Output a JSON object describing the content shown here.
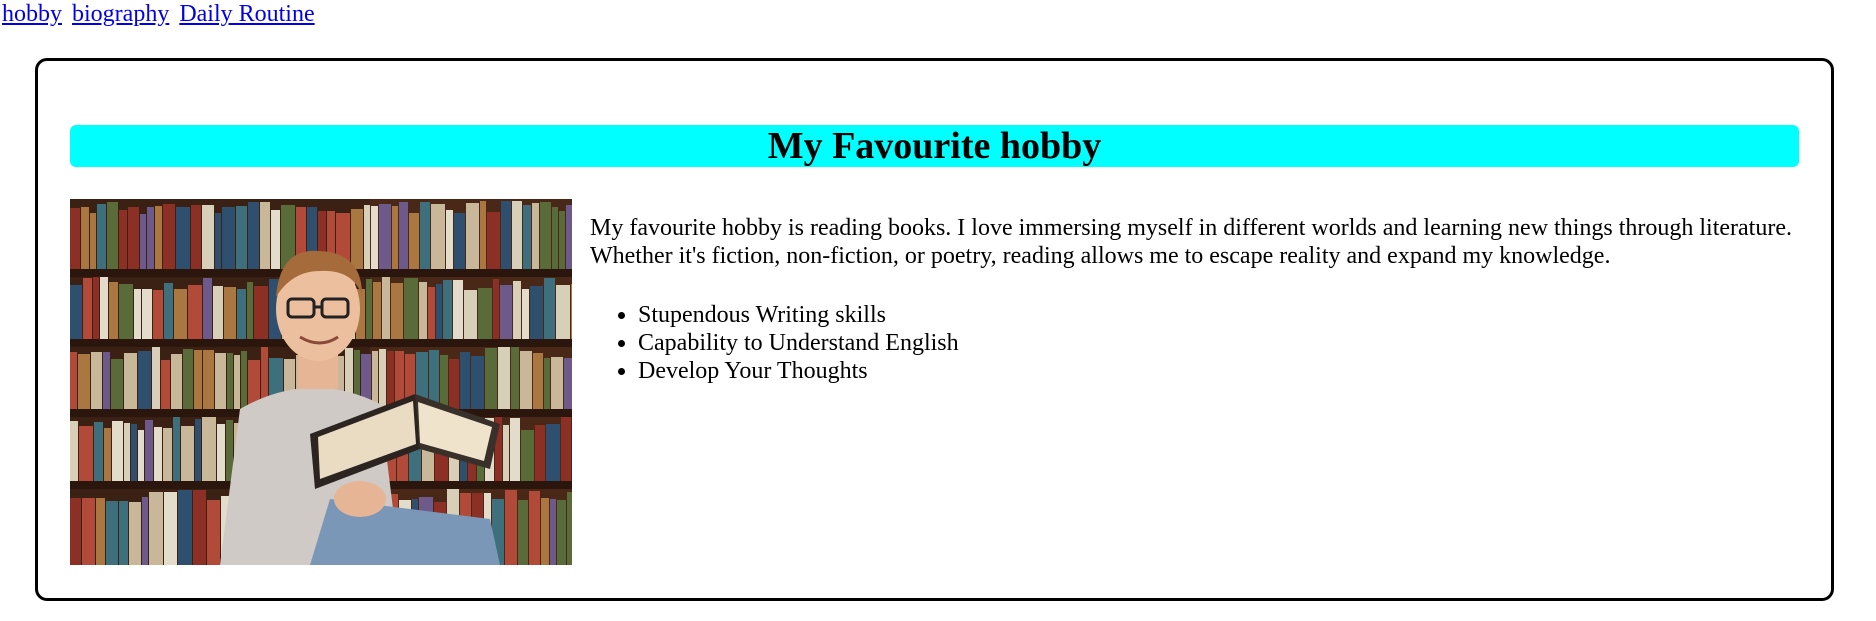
{
  "nav": {
    "links": [
      "hobby",
      "biography",
      "Daily Routine"
    ]
  },
  "card": {
    "heading": "My Favourite hobby",
    "heading_bg": "#00ffff",
    "image_icon": "person-reading-book-image",
    "description": "My favourite hobby is reading books. I love immersing myself in different worlds and learning new things through literature. Whether it's fiction, non-fiction, or poetry, reading allows me to escape reality and expand my knowledge.",
    "points": [
      "Stupendous Writing skills",
      "Capability to Understand English",
      "Develop Your Thoughts"
    ]
  },
  "colors": {
    "link": "#0000ee",
    "border": "#000000"
  }
}
